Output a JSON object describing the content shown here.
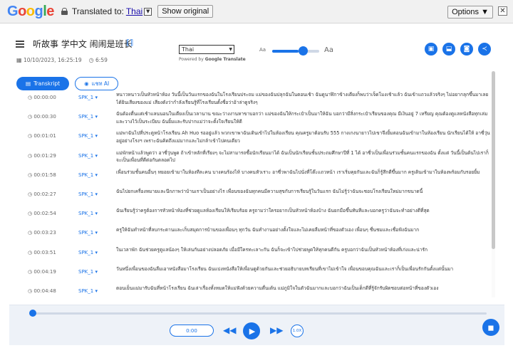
{
  "translate_bar": {
    "logo_letters": [
      {
        "ch": "G",
        "color": "#4285F4"
      },
      {
        "ch": "o",
        "color": "#EA4335"
      },
      {
        "ch": "o",
        "color": "#FBBC05"
      },
      {
        "ch": "g",
        "color": "#4285F4"
      },
      {
        "ch": "l",
        "color": "#34A853"
      },
      {
        "ch": "e",
        "color": "#EA4335"
      }
    ],
    "translated_to_label": "Translated to:",
    "language": "Thai",
    "show_original_label": "Show original",
    "options_label": "Options",
    "options_arrow": "▼",
    "close_glyph": "✕"
  },
  "header": {
    "title": "听故事 学中文 闹闹是班长",
    "date": "10/10/2023, 16:25:19",
    "duration": "6:59",
    "translate_language": "Thai",
    "powered_by_label": "Powered by",
    "powered_by_brand": "Google Translate",
    "font_small_label": "Aa",
    "font_large_label": "Aa",
    "font_size_level": 0.56,
    "icons": [
      "image-icon",
      "save-icon",
      "floppy-icon",
      "share-icon"
    ]
  },
  "tabs": {
    "transcript_label": "Transkript",
    "ai_label": "แชท AI"
  },
  "speaker_label": "SPK_1",
  "transcript": [
    {
      "time": "00:00:00",
      "text": "หนาวหนาวเป็นหัวหน้าห้อง วันนี้เป็นวันแรกของฉันในโรงเรียนประถม แม่ของฉันปลุกฉันในตอนเช้า ฉันดูนาฬิกาข้างเตียงก็พบว่าเจ็ดโมงเช้าแล้ว ฉันเข้าแถวแล้วจริงๆ ไม่อยากลุกขึ้นมาเลยได้ยินเสียงของแม่ เสียงดังว่ากำลังเรียนรู้ที่โรงเรียนตั้งชื่อว่าอ้าล่าดูจริงๆ"
    },
    {
      "time": "00:00:30",
      "text": "ฉันต้องตื่นแต่เช้าแลนนอนในเตียงเป็นเวลานาน ขณะว่างงานหาขาบอกว่า แม่ของฉันให้กระเป๋าเป็นมาให้ฉัน บอกว่ามีสิ่งกระเป๋าเรียนของคุณ มีเงินอยู่ 7 เหรียญ คุณต้องดูแลหนังสือทุกเล่มและวางไว้เป็นระเบียบ ฉันยิ้มและรับปากแม่ว่าจะตั้งใจเรียนให้ดี"
    },
    {
      "time": "00:01:01",
      "text": "แม่พาฉันไปที่ประตูหน้าโรงเรียน Ah Huo รออยู่แล้ว พวกเขาพาฉันเดินเข้าไปในห้องเรียน คุณครูมาต้อนรับ 555 กางเกงนายาวไปเขาจึงยิ้มตอนฉันเข้ามาในห้องเรียน นักเรียนได้ให้ อาซี่วุ่นอยู่อย่างโรงฯ เพราะฉันคิดถึงแม่มากและไม่กล้าเข้าไปคนเดียว"
    },
    {
      "time": "00:01:29",
      "text": "แม่พักหน้าแล้วพูดว่า อาซี่วุ่นพูด ถ้าเข้าหลักที่เรียงๆ จะไม่สามารถซื้อนักเรียนมาได้ ฉันเป็นนักเรียนชั้นประถมศึกษาปีที่ 1 ได้ อาซี่วเป็นเพื่อนร่วมชั้นคนแรกของฉัน ตั้งแต่ วันนี้เป็นต้นไปเราก็จะเป็นเพื่อนที่ดีต่อกันตลอดไป"
    },
    {
      "time": "00:01:58",
      "text": "เพื่อนร่วมชั้นคนอื่นๆ ทยอยเข้ามาในห้องทีละคน บางคนร้องไห้ บางคนหัวเราะ อาซี่วพาฉันไปนั่งที่โต๊ะแถวหน้า เราเริ่มคุยกันและฉันก็รู้สึกดีขึ้นมาก ครูเดินเข้ามาในห้องพร้อมกับรอยยิ้ม"
    },
    {
      "time": "00:02:27",
      "text": "ฉันไปยกเครื่องหมายและนึกภาพว่าบ้านเราเป็นอย่างไร เพื่อนของฉันทุกคนมีความสุขกับการเรียนรู้ในวันแรก ฉันไม่รู้ว่าฉันจะชอบโรงเรียนใหม่มากขนาดนี้"
    },
    {
      "time": "00:02:54",
      "text": "ฉันเรียนรู้ว่าครูต้องการหัวหน้าห้องที่ช่วยดูแลห้องเรียนให้เรียบร้อย ครูถามว่าใครอยากเป็นหัวหน้าห้องบ้าง ฉันยกมือขึ้นทันทีและบอกครูว่าฉันจะทำอย่างดีที่สุด"
    },
    {
      "time": "00:03:23",
      "text": "ครูให้ฉันทำหน้าที่ลบกระดานและเก็บสมุดการบ้านของเพื่อนๆ ทุกวัน ฉันทำงานอย่างตั้งใจและไม่เคยลืมหน้าที่ของตัวเอง เพื่อนๆ ชื่นชมและเชื่อฟังฉันมาก"
    },
    {
      "time": "00:03:51",
      "text": "ในเวลาพัก ฉันช่วยครูดูแลน้องๆ ให้เล่นกันอย่างปลอดภัย เมื่อมีใครทะเลาะกัน ฉันก็จะเข้าไปช่วยพูดให้ทุกคนดีกัน ครูบอกว่าฉันเป็นหัวหน้าห้องที่เก่งและน่ารัก"
    },
    {
      "time": "00:04:19",
      "text": "วันหนึ่งเพื่อนของฉันลืมเอาหนังสือมาโรงเรียน ฉันแบ่งหนังสือให้เพื่อนดูด้วยกันและช่วยอธิบายบทเรียนที่เขาไม่เข้าใจ เพื่อนขอบคุณฉันและเราก็เป็นเพื่อนรักกันตั้งแต่นั้นมา"
    },
    {
      "time": "00:04:48",
      "text": "ตอนเย็นแม่มารับฉันที่หน้าโรงเรียน ฉันเล่าเรื่องทั้งหมดให้แม่ฟังด้วยความตื่นเต้น แม่ภูมิใจในตัวฉันมากและบอกว่าฉันเป็นเด็กดีที่รู้จักรับผิดชอบต่อหน้าที่ของตัวเอง"
    }
  ],
  "player": {
    "current_time": "0:00",
    "speed": "1.0X",
    "progress": 0
  }
}
